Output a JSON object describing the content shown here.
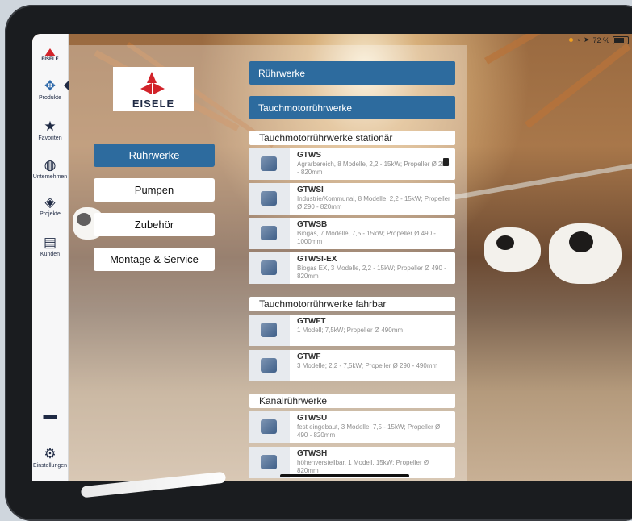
{
  "status_bar": {
    "battery": "72 %"
  },
  "brand": {
    "mini": "EISELE",
    "word": "EISELE"
  },
  "sidebar": {
    "items": [
      {
        "label": "Produkte",
        "icon": "products-icon"
      },
      {
        "label": "Favoriten",
        "icon": "star-icon"
      },
      {
        "label": "Unternehmen",
        "icon": "globe-icon"
      },
      {
        "label": "Projekte",
        "icon": "layers-icon"
      },
      {
        "label": "Kunden",
        "icon": "contact-card-icon"
      },
      {
        "label": "",
        "icon": "chat-icon"
      },
      {
        "label": "Einstellungen",
        "icon": "gear-icon"
      }
    ]
  },
  "categories": [
    "Rührwerke",
    "Pumpen",
    "Zubehör",
    "Montage & Service"
  ],
  "list": {
    "header1": "Rührwerke",
    "header2": "Tauchmotorrührwerke",
    "sections": [
      {
        "title": "Tauchmotorrührwerke stationär",
        "products": [
          {
            "name": "GTWS",
            "desc": "Agrarbereich, 8 Modelle, 2,2 - 15kW; Propeller Ø 290 - 820mm"
          },
          {
            "name": "GTWSI",
            "desc": "Industrie/Kommunal, 8 Modelle, 2,2 - 15kW; Propeller Ø 290 - 820mm"
          },
          {
            "name": "GTWSB",
            "desc": "Biogas, 7 Modelle, 7,5 - 15kW; Propeller Ø 490 - 1000mm"
          },
          {
            "name": "GTWSI-EX",
            "desc": "Biogas EX, 3 Modelle, 2,2 - 15kW; Propeller Ø 490 - 820mm"
          }
        ]
      },
      {
        "title": "Tauchmotorrührwerke fahrbar",
        "products": [
          {
            "name": "GTWFT",
            "desc": "1 Modell; 7,5kW; Propeller Ø 490mm"
          },
          {
            "name": "GTWF",
            "desc": "3 Modelle; 2,2 - 7,5kW; Propeller Ø 290 - 490mm"
          }
        ]
      },
      {
        "title": "Kanalrührwerke",
        "products": [
          {
            "name": "GTWSU",
            "desc": "fest eingebaut, 3 Modelle, 7,5 - 15kW; Propeller Ø 490 - 820mm"
          },
          {
            "name": "GTWSH",
            "desc": "höhenverstellbar, 1 Modell, 15kW; Propeller Ø 820mm"
          }
        ]
      }
    ]
  }
}
